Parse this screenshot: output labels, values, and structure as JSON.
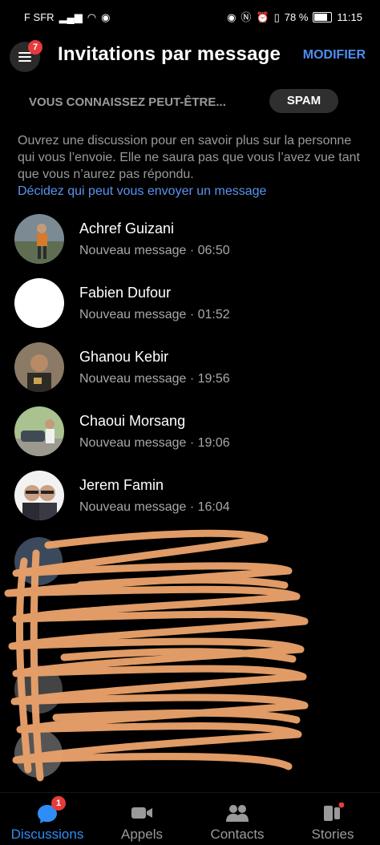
{
  "status_bar": {
    "carrier": "F SFR",
    "battery": "78 %",
    "time": "11:15"
  },
  "header": {
    "title": "Invitations par message",
    "menu_badge": "7",
    "modify_label": "MODIFIER"
  },
  "tabs": {
    "people_you_may_know": "VOUS CONNAISSEZ PEUT-ÊTRE...",
    "spam": "SPAM"
  },
  "info": {
    "text": "Ouvrez une discussion pour en savoir plus sur la personne qui vous l’envoie. Elle ne saura pas que vous l’avez vue tant que vous n’aurez pas répondu.",
    "link": "Décidez qui peut vous envoyer un message"
  },
  "requests": [
    {
      "name": "Achref Guizani",
      "subtitle": "Nouveau message · 06:50"
    },
    {
      "name": "Fabien Dufour",
      "subtitle": "Nouveau message · 01:52"
    },
    {
      "name": "Ghanou Kebir",
      "subtitle": "Nouveau message · 19:56"
    },
    {
      "name": "Chaoui Morsang",
      "subtitle": "Nouveau message · 19:06"
    },
    {
      "name": "Jerem Famin",
      "subtitle": "Nouveau message · 16:04"
    }
  ],
  "bottom_nav": {
    "discussions": "Discussions",
    "discussions_badge": "1",
    "calls": "Appels",
    "contacts": "Contacts",
    "stories": "Stories"
  },
  "colors": {
    "accent": "#4d8ef0",
    "active_tab": "#2f8df6",
    "badge": "#e63b3b",
    "scribble": "#e8a06a"
  }
}
